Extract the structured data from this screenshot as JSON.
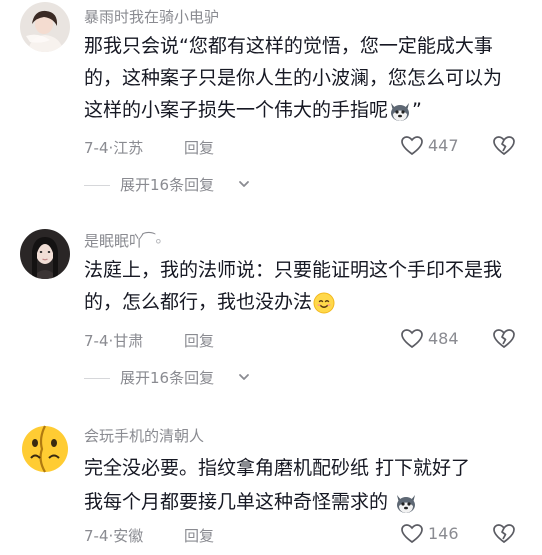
{
  "comments": [
    {
      "username": "暴雨时我在骑小电驴",
      "text": "那我只会说“您都有这样的觉悟，您一定能成大事的，这种案子只是你人生的小波澜，您怎么可以为这样的小案子损失一个伟大的手指呢",
      "text_suffix": "”",
      "inline_emoji": "husky-dog-emoji",
      "date": "7-4",
      "location": "江苏",
      "reply_label": "回复",
      "likes": "447",
      "expand_label": "展开16条回复"
    },
    {
      "username": "是眠眠吖",
      "username_decoration": "͡ ∘",
      "text": "法庭上，我的法师说：只要能证明这个手印不是我的，怎么都行，我也没办法",
      "inline_emoji": "smiling-face-emoji",
      "date": "7-4",
      "location": "甘肃",
      "reply_label": "回复",
      "likes": "484",
      "expand_label": "展开16条回复"
    },
    {
      "username": "会玩手机的清朝人",
      "text_line1": "完全没必要。指纹拿角磨机配砂纸 打下就好了",
      "text_line2": "我每个月都要接几单这种奇怪需求的",
      "inline_emoji": "husky-dog-emoji",
      "date": "7-4",
      "location": "安徽",
      "reply_label": "回复",
      "likes": "146"
    }
  ],
  "meta_separator": "·",
  "colors": {
    "text_primary": "#161823",
    "text_secondary": "#8a8b91",
    "icon_stroke": "#5b5c63"
  }
}
